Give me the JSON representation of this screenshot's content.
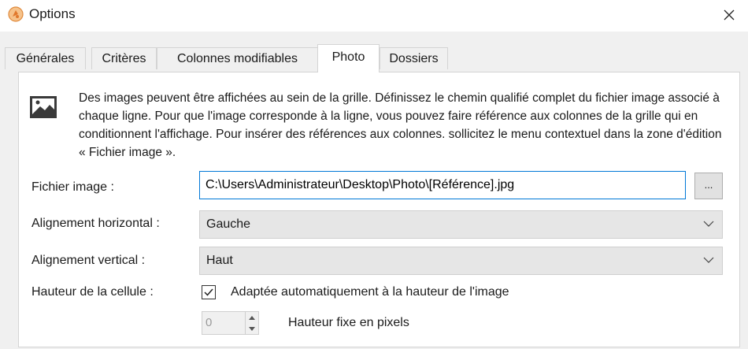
{
  "window": {
    "title": "Options",
    "icon": "app-icon",
    "close_icon": "close-icon"
  },
  "tabs": [
    {
      "label": "Générales",
      "active": false
    },
    {
      "label": "Critères",
      "active": false
    },
    {
      "label": "Colonnes modifiables",
      "active": false
    },
    {
      "label": "Photo",
      "active": true
    },
    {
      "label": "Dossiers",
      "active": false
    }
  ],
  "photo": {
    "icon": "image-icon",
    "description": "Des images peuvent être affichées au sein de la grille. Définissez le chemin qualifié complet du fichier image associé à chaque ligne. Pour que l'image corresponde à la ligne, vous pouvez faire référence aux colonnes de la grille qui en conditionnent l'affichage. Pour insérer des références aux colonnes. sollicitez le menu contextuel dans la zone d'édition « Fichier image ».",
    "file_label": "Fichier image :",
    "file_value": "C:\\Users\\Administrateur\\Desktop\\Photo\\[Référence].jpg",
    "browse_label": "...",
    "h_align_label": "Alignement horizontal :",
    "h_align_value": "Gauche",
    "v_align_label": "Alignement vertical :",
    "v_align_value": "Haut",
    "height_label": "Hauteur de la cellule :",
    "auto_height_label": "Adaptée automatiquement à la hauteur de l'image",
    "auto_height_checked": true,
    "fixed_height_value": "0",
    "fixed_height_label": "Hauteur fixe en pixels"
  },
  "colors": {
    "accent": "#0078d7",
    "window_bg": "#f0f0f0",
    "panel_bg": "#ffffff"
  }
}
